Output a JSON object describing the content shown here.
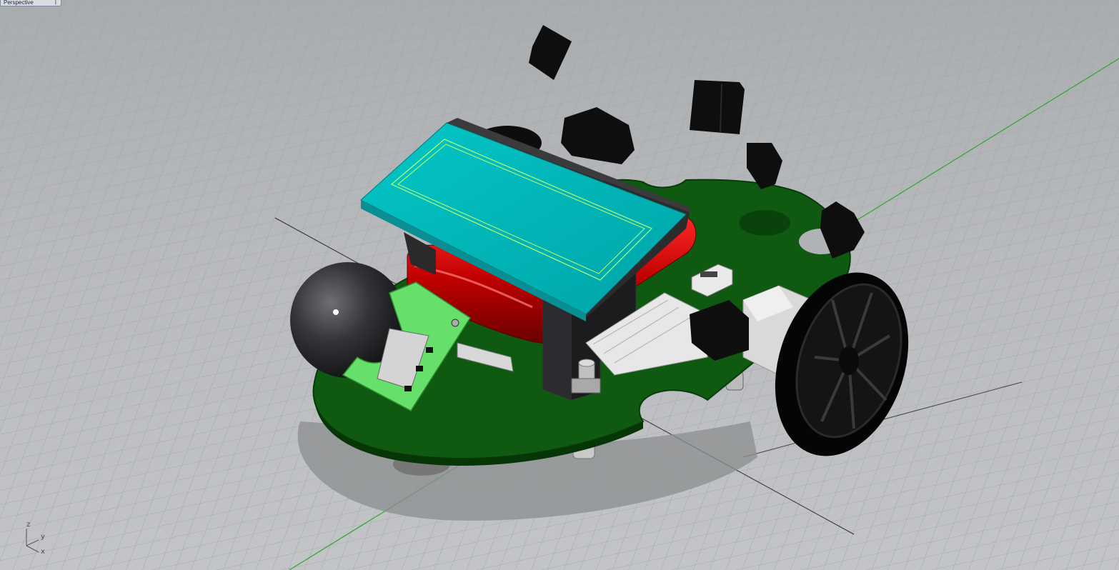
{
  "viewport": {
    "title": "Perspective",
    "menu_caret": "|"
  },
  "axes": {
    "z": "z",
    "y": "y",
    "x": "x"
  },
  "colors": {
    "background": "#b7b9bc",
    "grid_line": "#9fa2a5",
    "x_axis_line": "#2f2f2f",
    "y_axis_line": "#2bb02b",
    "pcb_green": "#0f5a10",
    "lcd_cyan": "#00b4b4",
    "battery_red": "#c40000",
    "sensor_board": "#66e06a",
    "black_parts": "#111111"
  },
  "icons": [
    "axis-gizmo-icon",
    "robot-model-icon"
  ]
}
